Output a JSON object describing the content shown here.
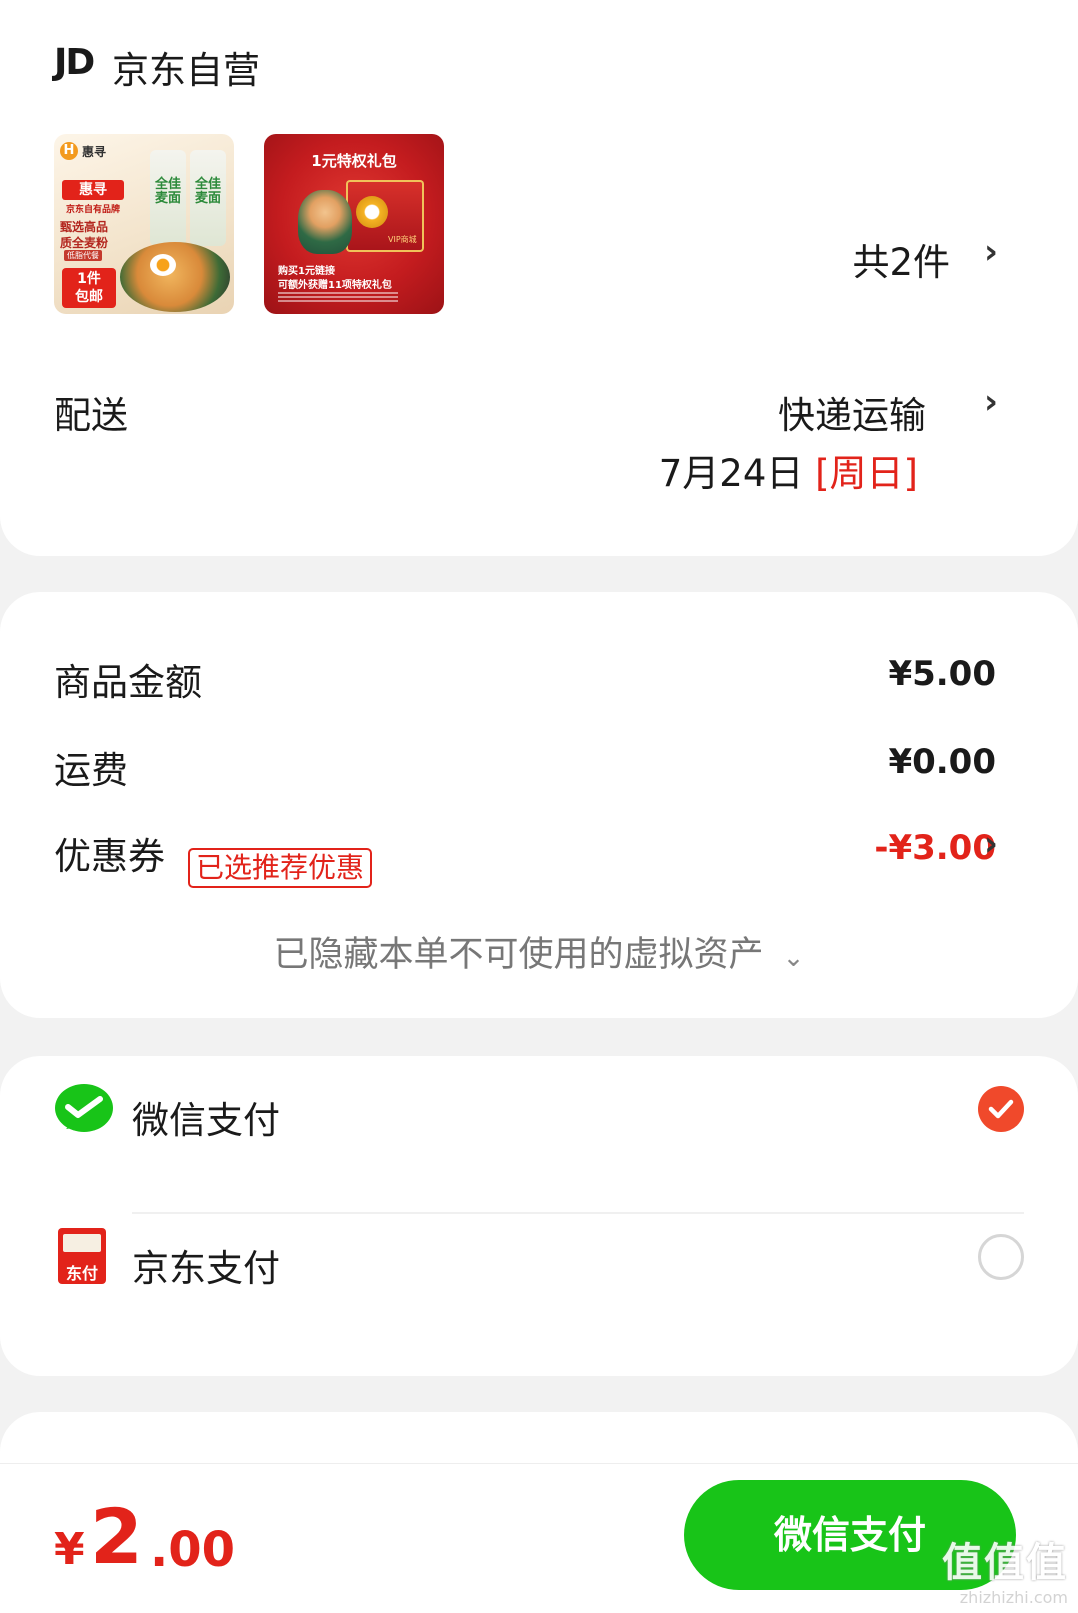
{
  "shop": {
    "logo": "JD",
    "name": "京东自营",
    "products": [
      {
        "brand": "惠寻",
        "tags": [
          "全佳麦面",
          "全佳麦面"
        ],
        "badge": "惠寻",
        "sub": "京东自有品牌",
        "lines": [
          "甄选高品",
          "质全麦粉"
        ],
        "note": "低脂代餐",
        "promo": [
          "1件",
          "包邮"
        ]
      },
      {
        "title": "1元特权礼包",
        "vip": "VIP商城",
        "caption_1": "购买1元链接",
        "caption_2": "可额外获赠11项特权礼包"
      }
    ],
    "item_count": "共2件"
  },
  "shipping": {
    "label": "配送",
    "method": "快递运输",
    "date": "7月24日",
    "weekday": "[周日]"
  },
  "summary": {
    "goods_label": "商品金额",
    "goods_value": "¥5.00",
    "freight_label": "运费",
    "freight_value": "¥0.00",
    "coupon_label": "优惠券",
    "coupon_badge": "已选推荐优惠",
    "coupon_value": "-¥3.00",
    "hidden_assets": "已隐藏本单不可使用的虚拟资产"
  },
  "payment": {
    "options": [
      {
        "label": "微信支付",
        "selected": true
      },
      {
        "label": "京东支付",
        "selected": false,
        "icon_text": "东付"
      }
    ]
  },
  "footer": {
    "currency": "¥",
    "total_int": "2",
    "total_dec": ".00",
    "pay_button": "微信支付"
  },
  "watermark": {
    "text": "值值值",
    "url": "zhizhizhi.com"
  },
  "colors": {
    "accent_red": "#e2231a",
    "wechat_green": "#18c418",
    "check_orange": "#f0492b"
  },
  "icons": [
    "chevron-right-icon",
    "chevron-down-icon",
    "wechat-pay-icon",
    "jd-pay-icon",
    "check-icon"
  ]
}
